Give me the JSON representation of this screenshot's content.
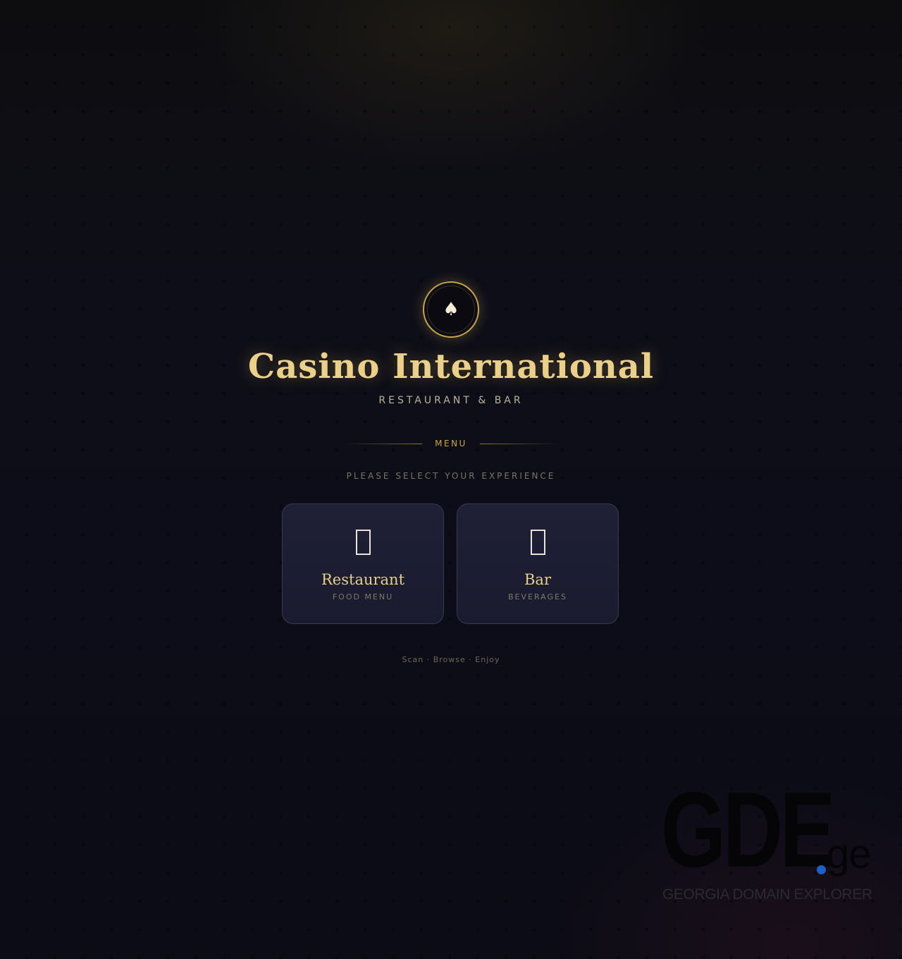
{
  "brand": {
    "logo_icon": "spade-icon",
    "logo_glyph": "♠",
    "title": "Casino International",
    "subtitle": "RESTAURANT & BAR"
  },
  "menu": {
    "label": "MENU",
    "prompt": "PLEASE SELECT YOUR EXPERIENCE",
    "cards": [
      {
        "icon": "missing-glyph-icon",
        "title": "Restaurant",
        "subtitle": "FOOD MENU"
      },
      {
        "icon": "missing-glyph-icon",
        "title": "Bar",
        "subtitle": "BEVERAGES"
      }
    ],
    "tagline": "Scan · Browse · Enjoy"
  },
  "watermark": {
    "logo_text": "GDE",
    "logo_tld": "ge",
    "tagline": "GEORGIA DOMAIN EXPLORER"
  },
  "colors": {
    "gold": "#e6cf8a",
    "gold_ring": "#c9a54e",
    "card_bg": "#1f2036",
    "background": "#0d0d16",
    "watermark_dot": "#1f5fc8"
  }
}
